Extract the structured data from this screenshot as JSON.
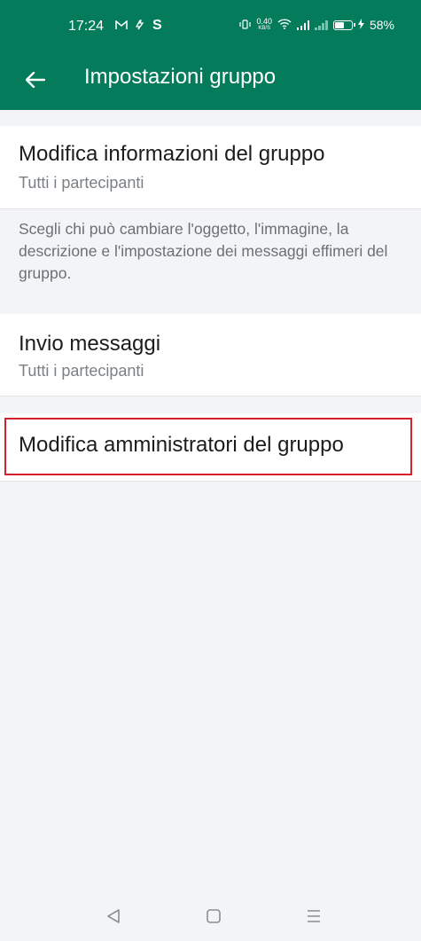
{
  "status": {
    "time": "17:24",
    "left_icons": [
      "gmail-icon",
      "arrow-up-icon",
      "s-app-icon"
    ],
    "speed_value": "0.40",
    "speed_unit": "KB/S",
    "battery": "58%",
    "battery_level": 0.58
  },
  "toolbar": {
    "title": "Impostazioni gruppo",
    "back_icon": "arrow-left-icon"
  },
  "settings": {
    "edit_info": {
      "title": "Modifica informazioni del gruppo",
      "value": "Tutti i partecipanti"
    },
    "description": "Scegli chi può cambiare l'oggetto, l'immagine, la descrizione e l'impostazione dei messaggi effimeri del gruppo.",
    "send_messages": {
      "title": "Invio messaggi",
      "value": "Tutti i partecipanti"
    },
    "edit_admins": {
      "title": "Modifica amministratori del gruppo"
    }
  },
  "colors": {
    "header": "#047c5b",
    "background": "#f3f4f6",
    "highlight": "#d3202a"
  },
  "nav": [
    "back-triangle-icon",
    "home-square-icon",
    "menu-lines-icon"
  ]
}
